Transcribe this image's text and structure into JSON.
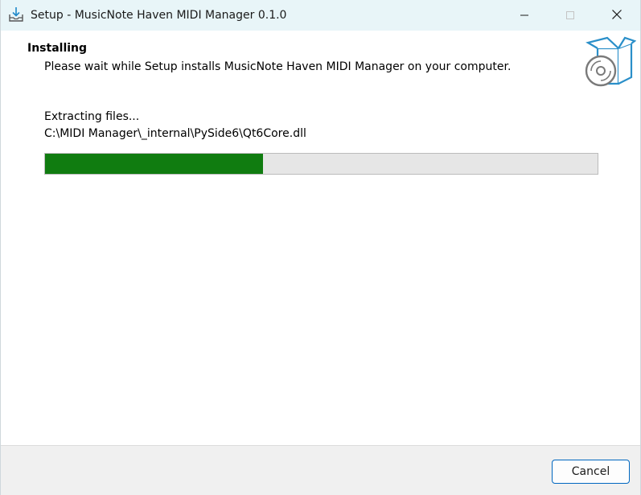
{
  "window": {
    "title": "Setup - MusicNote Haven MIDI Manager 0.1.0",
    "icons": {
      "app": "download-tray-icon",
      "minimize": "minimize-icon",
      "maximize": "maximize-icon",
      "close": "close-icon",
      "header": "software-box-icon"
    }
  },
  "header": {
    "title": "Installing",
    "subtitle": "Please wait while Setup installs MusicNote Haven MIDI Manager on your computer."
  },
  "progress": {
    "status": "Extracting files...",
    "current_file": "C:\\MIDI Manager\\_internal\\PySide6\\Qt6Core.dll",
    "percent": 39.5,
    "fill_color": "#107c10"
  },
  "footer": {
    "cancel_label": "Cancel"
  }
}
